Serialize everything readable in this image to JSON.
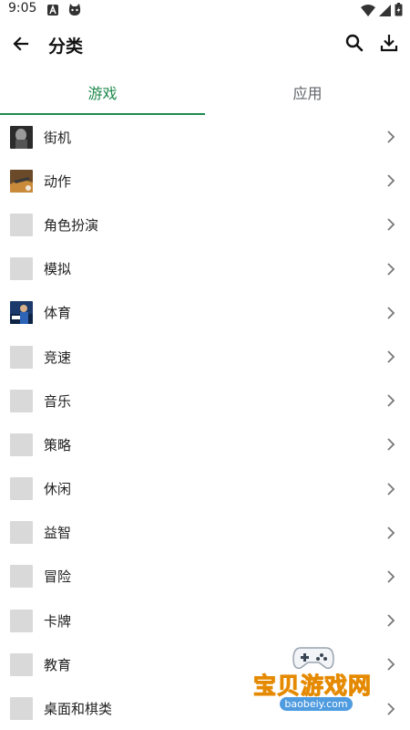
{
  "status_bar": {
    "time": "9:05",
    "left_icons": [
      "a-notification-icon",
      "cat-notification-icon"
    ],
    "right_icons": [
      "wifi-icon",
      "signal-icon",
      "battery-icon"
    ]
  },
  "app_bar": {
    "title": "分类",
    "back_icon": "arrow-left-icon",
    "search_icon": "search-icon",
    "download_icon": "download-icon"
  },
  "tabs": [
    {
      "label": "游戏",
      "active": true
    },
    {
      "label": "应用",
      "active": false
    }
  ],
  "colors": {
    "accent": "#1e8a4c",
    "placeholder": "#d9d9d9",
    "watermark_orange": "#f5a31a",
    "watermark_blue": "#4f9be0"
  },
  "categories": [
    {
      "label": "街机",
      "thumb": "arcade-thumbnail"
    },
    {
      "label": "动作",
      "thumb": "action-thumbnail"
    },
    {
      "label": "角色扮演",
      "thumb": "placeholder"
    },
    {
      "label": "模拟",
      "thumb": "placeholder"
    },
    {
      "label": "体育",
      "thumb": "sports-thumbnail"
    },
    {
      "label": "竞速",
      "thumb": "placeholder"
    },
    {
      "label": "音乐",
      "thumb": "placeholder"
    },
    {
      "label": "策略",
      "thumb": "placeholder"
    },
    {
      "label": "休闲",
      "thumb": "placeholder"
    },
    {
      "label": "益智",
      "thumb": "placeholder"
    },
    {
      "label": "冒险",
      "thumb": "placeholder"
    },
    {
      "label": "卡牌",
      "thumb": "placeholder"
    },
    {
      "label": "教育",
      "thumb": "placeholder"
    },
    {
      "label": "桌面和棋类",
      "thumb": "placeholder"
    }
  ],
  "watermark": {
    "text": "宝贝游戏网",
    "url": "baobeiy.com"
  }
}
